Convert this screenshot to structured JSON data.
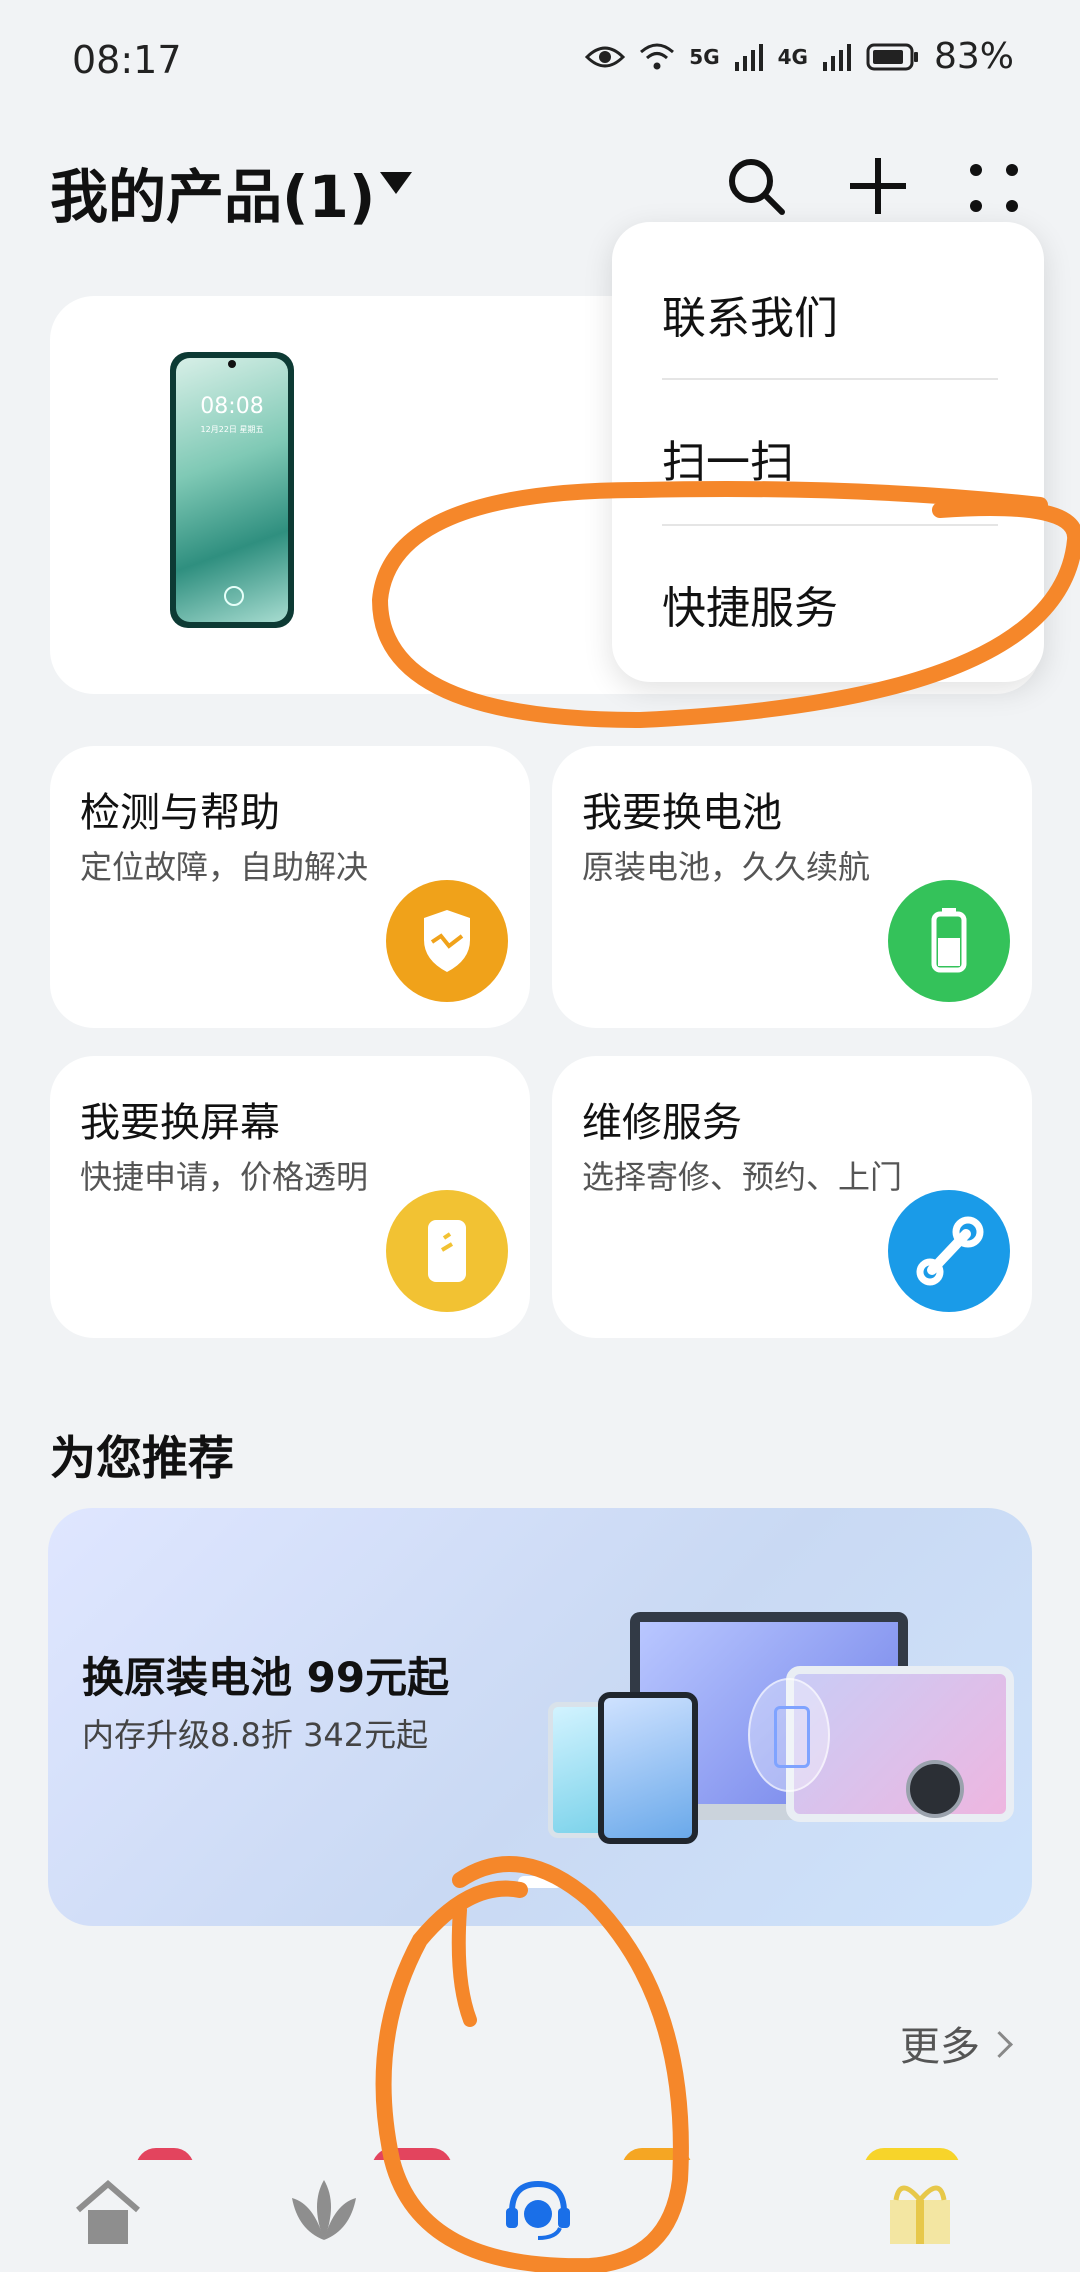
{
  "status_bar": {
    "time": "08:17",
    "net1": "5G",
    "net2": "4G",
    "battery": "83%"
  },
  "header": {
    "title": "我的产品(1)"
  },
  "product": {
    "phone_time": "08:08",
    "phone_date": "12月22日 星期五"
  },
  "menu": {
    "items": [
      {
        "label": "联系我们"
      },
      {
        "label": "扫一扫"
      },
      {
        "label": "快捷服务"
      }
    ]
  },
  "tiles": [
    {
      "title": "检测与帮助",
      "subtitle": "定位故障，自助解决",
      "color": "#f0a21a"
    },
    {
      "title": "我要换电池",
      "subtitle": "原装电池，久久续航",
      "color": "#34c25a"
    },
    {
      "title": "我要换屏幕",
      "subtitle": "快捷申请，价格透明",
      "color": "#f2c233"
    },
    {
      "title": "维修服务",
      "subtitle": "选择寄修、预约、上门",
      "color": "#1a9be8"
    }
  ],
  "recommend": {
    "title": "为您推荐",
    "banner_title": "换原装电池 99元起",
    "banner_sub": "内存升级8.8折 342元起",
    "more": "更多"
  },
  "colors": {
    "annotation": "#f5872a",
    "tab_active": "#1a6fe8"
  },
  "tabbar": {
    "icons": [
      "home-icon",
      "lotus-icon",
      "service-headset-icon",
      "gift-icon"
    ]
  }
}
